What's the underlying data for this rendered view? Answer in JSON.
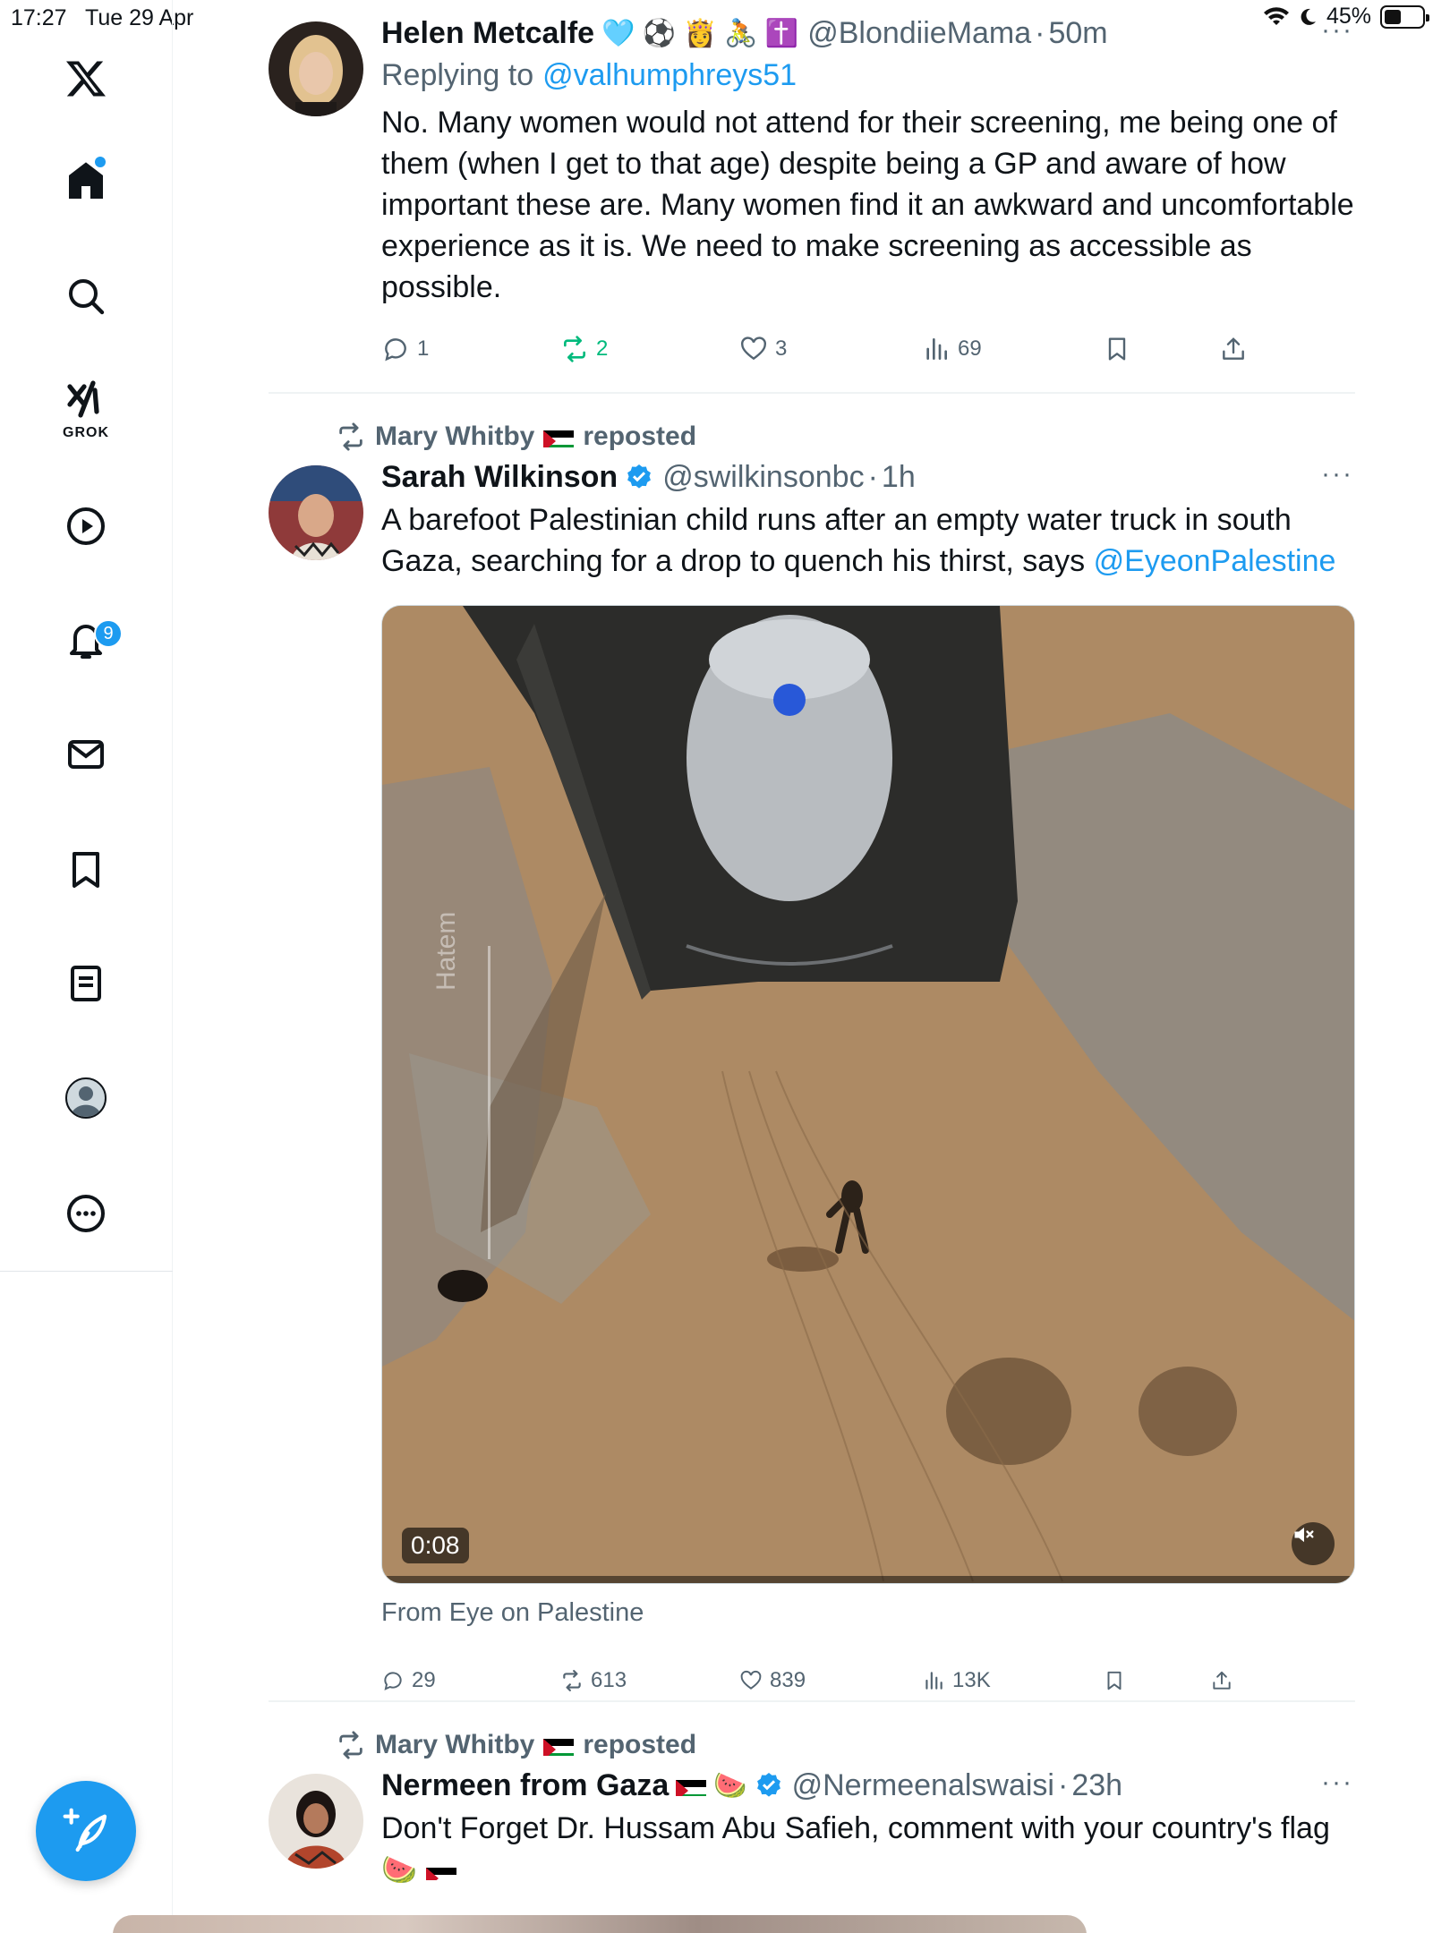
{
  "status_bar": {
    "time": "17:27",
    "date": "Tue 29 Apr",
    "battery": "45%",
    "battery_level": 0.45
  },
  "sidebar": {
    "notifications_badge": "9",
    "grok_label": "GROK",
    "items": [
      "x-logo",
      "home",
      "search",
      "grok",
      "videos",
      "notifications",
      "messages",
      "bookmarks",
      "lists",
      "profile",
      "more"
    ]
  },
  "tweets": [
    {
      "name": "Helen Metcalfe",
      "emojis": "🩵 ⚽ 👸 🚴 ✝️",
      "handle": "@BlondiieMama",
      "time": "50m",
      "replying_label": "Replying to",
      "replying_to": "@valhumphreys51",
      "text": "No. Many women would not attend for their screening, me being one of them (when I get to that age) despite being a GP and aware of how important these are. Many women find it an awkward and uncomfortable experience as it is. We need to make screening as accessible as possible.",
      "replies": "1",
      "reposts": "2",
      "likes": "3",
      "views": "69"
    },
    {
      "reposter": "Mary Whitby",
      "reposted_label": "reposted",
      "name": "Sarah Wilkinson",
      "handle": "@swilkinsonbc",
      "time": "1h",
      "text": "A barefoot Palestinian child runs after an empty water truck in south Gaza, searching for a drop to quench his thirst, says",
      "mention": "@EyeonPalestine",
      "video_duration": "0:08",
      "watermark": "Hatem",
      "source": "From Eye on Palestine",
      "replies": "29",
      "reposts": "613",
      "likes": "839",
      "views": "13K"
    },
    {
      "reposter": "Mary Whitby",
      "reposted_label": "reposted",
      "name": "Nermeen from Gaza",
      "name_suffix": "🍉",
      "handle": "@Nermeenalswaisi",
      "time": "23h",
      "text": "Don't Forget Dr. Hussam Abu Safieh, comment with your country's flag",
      "text_emoji": "🍉"
    }
  ],
  "colors": {
    "accent": "#1d9bf0",
    "muted": "#536471",
    "repost_green": "#00ba7c",
    "text": "#0f1419"
  }
}
